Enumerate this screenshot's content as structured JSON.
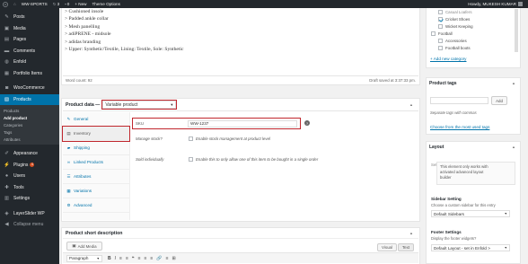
{
  "adminbar": {
    "wp_icon": "wordpress-icon",
    "site_name": "WW-SPORTS",
    "updates_count": "3",
    "comments_count": "0",
    "new_label": "+ New",
    "theme_options": "Theme Options",
    "howdy": "Howdy, MUKESH KUMAR"
  },
  "sidebar": {
    "items": [
      {
        "label": "Posts",
        "icon": "pushpin-icon"
      },
      {
        "label": "Media",
        "icon": "media-icon"
      },
      {
        "label": "Pages",
        "icon": "pages-icon"
      },
      {
        "label": "Comments",
        "icon": "comments-icon"
      },
      {
        "label": "Enfold",
        "icon": "enfold-icon"
      },
      {
        "label": "Portfolio Items",
        "icon": "portfolio-icon"
      },
      {
        "label": "WooCommerce",
        "icon": "woocommerce-icon"
      },
      {
        "label": "Products",
        "icon": "products-icon"
      }
    ],
    "submenu": [
      "Products",
      "Add product",
      "Categories",
      "Tags",
      "Attributes"
    ],
    "lower_items": [
      {
        "label": "Appearance",
        "icon": "appearance-icon"
      },
      {
        "label": "Plugins",
        "icon": "plugins-icon",
        "badge": "4"
      },
      {
        "label": "Users",
        "icon": "users-icon"
      },
      {
        "label": "Tools",
        "icon": "tools-icon"
      },
      {
        "label": "Settings",
        "icon": "settings-icon"
      },
      {
        "label": "LayerSlider WP",
        "icon": "layerslider-icon"
      },
      {
        "label": "Collapse menu",
        "icon": "collapse-icon"
      }
    ]
  },
  "description": {
    "lines": [
      "> Cushioned insole",
      "> Padded ankle collar",
      "> Mesh panelling",
      "> adiPRENE - midsole",
      "> adidas branding",
      "> Upper: Synthetic/Textile, Lining: Textile, Sole: Synthetic"
    ],
    "word_count": "Word count: 92",
    "last_edited": "Draft saved at 3:37:33 pm."
  },
  "product_data": {
    "title": "Product data —",
    "type_value": "Variable product",
    "tabs": [
      {
        "label": "General",
        "icon": "wrench-icon"
      },
      {
        "label": "Inventory",
        "icon": "inventory-icon"
      },
      {
        "label": "Shipping",
        "icon": "truck-icon"
      },
      {
        "label": "Linked Products",
        "icon": "link-icon"
      },
      {
        "label": "Attributes",
        "icon": "list-icon"
      },
      {
        "label": "Variations",
        "icon": "grid-icon"
      },
      {
        "label": "Advanced",
        "icon": "gear-icon"
      }
    ],
    "sku_label": "SKU",
    "sku_value": "WW-1237",
    "manage_stock_label": "Manage stock?",
    "manage_stock_text": "Enable stock management at product level",
    "sold_individually_label": "Sold individually",
    "sold_individually_text": "Enable this to only allow one of this item to be bought in a single order"
  },
  "short_description": {
    "title": "Product short description",
    "add_media": "Add Media",
    "paragraph": "Paragraph",
    "visual_tab": "Visual",
    "text_tab": "Text",
    "toolbar": [
      "B",
      "I",
      "≡",
      "≡",
      "❝",
      "≡",
      "≡",
      "≡",
      "🔗",
      "≡",
      "⊞"
    ]
  },
  "right": {
    "categories": [
      {
        "label": "Casual Loafers",
        "checked": false
      },
      {
        "label": "Cricket Shoes",
        "checked": true
      },
      {
        "label": "Wicket Keeping",
        "checked": false
      },
      {
        "label": "Football",
        "checked": false
      },
      {
        "label": "Accessories",
        "checked": false
      },
      {
        "label": "Football boots",
        "checked": false
      }
    ],
    "add_category": "+ Add new category",
    "tags_title": "Product tags",
    "tags_add": "Add",
    "tags_hint": "Separate tags with commas",
    "tags_choose": "Choose from the most used tags",
    "layout_title": "Layout",
    "layout_note_1": "This element only works with",
    "layout_note_2": "activated advanced layout",
    "layout_note_3": "builder",
    "layout_side": "Set",
    "sidebar_title": "Sidebar Setting",
    "sidebar_desc": "Choose a custom sidebar for this entry",
    "sidebar_value": "Default Sidebars",
    "footer_title": "Footer Settings",
    "footer_desc": "Display the footer widgets?",
    "footer_value": "Default Layout - set in Enfold >"
  }
}
